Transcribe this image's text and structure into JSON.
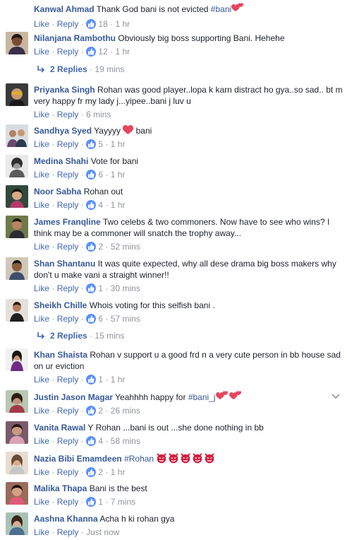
{
  "comments": [
    {
      "author": "Kanwal Ahmad",
      "text": "Thank God bani is not evicted ",
      "hashtag": "#bani",
      "like": "Like",
      "reply": "Reply",
      "likes": "18",
      "time": "1 hr"
    },
    {
      "author": "Nilanjana Rambothu",
      "text": "Obviously big boss supporting Bani. Hehehe",
      "like": "Like",
      "reply": "Reply",
      "likes": "12",
      "time": "1 hr",
      "replies_label": "2 Replies",
      "replies_time": "19 mins"
    },
    {
      "author": "Priyanka Singh",
      "text": "Rohan was good player..lopa k karn distract ho gya..so sad.. bt m very happy fr my lady j...yipee..bani j luv u",
      "like": "Like",
      "reply": "Reply",
      "time": "6 mins"
    },
    {
      "author": "Sandhya Syed",
      "text": "Yayyyy ",
      "text_after": " bani",
      "like": "Like",
      "reply": "Reply",
      "likes": "5",
      "time": "1 hr"
    },
    {
      "author": "Medina Shahi",
      "text": "Vote for bani",
      "like": "Like",
      "reply": "Reply",
      "likes": "6",
      "time": "1 hr"
    },
    {
      "author": "Noor Sabha",
      "text": "Rohan out",
      "like": "Like",
      "reply": "Reply",
      "likes": "4",
      "time": "1 hr"
    },
    {
      "author": "James Franqline",
      "text": "Two celebs & two commoners. Now have to see who wins? I think may be a commoner will snatch the trophy away...",
      "like": "Like",
      "reply": "Reply",
      "likes": "2",
      "time": "52 mins"
    },
    {
      "author": "Shan Shantanu",
      "text": "It was quite expected, why all dese drama big boss makers why don't u make vani a straight winner!!",
      "like": "Like",
      "reply": "Reply",
      "likes": "1",
      "time": "30 mins"
    },
    {
      "author": "Sheikh Chille",
      "text": "Whois voting for this selfish bani .",
      "like": "Like",
      "reply": "Reply",
      "likes": "6",
      "time": "57 mins",
      "replies_label": "2 Replies",
      "replies_time": "15 mins"
    },
    {
      "author": "Khan Shaista",
      "text": "Rohan v support u a good frd n a very cute person in bb house sad on ur eviction",
      "like": "Like",
      "reply": "Reply",
      "likes": "1",
      "time": "1 hr"
    },
    {
      "author": "Justin Jason Magar",
      "text": "Yeahhhh happy for ",
      "hashtag": "#bani_j",
      "like": "Like",
      "reply": "Reply",
      "likes": "2",
      "time": "26 mins"
    },
    {
      "author": "Vanita Rawal",
      "text": "Y Rohan ...bani is out ...she done nothing in bb",
      "like": "Like",
      "reply": "Reply",
      "likes": "4",
      "time": "58 mins"
    },
    {
      "author": "Nazia Bibi Emamdeen",
      "text": "",
      "hashtag": "#Rohan",
      "like": "Like",
      "reply": "Reply",
      "likes": "2",
      "time": "1 hr"
    },
    {
      "author": "Malika Thapa",
      "text": "Bani is the best",
      "like": "Like",
      "reply": "Reply",
      "likes": "1",
      "time": "7 mins"
    },
    {
      "author": "Aashna Khanna",
      "text": "Acha h ki rohan gya",
      "like": "Like",
      "reply": "Reply",
      "time": "Just now"
    }
  ],
  "separator": "·",
  "colors": {
    "link": "#4267b2",
    "author": "#365899",
    "meta": "#90949c",
    "like_badge": "#5890ff",
    "heart": "#e8455d",
    "devil": "#d1203f"
  },
  "icons": {
    "like": "thumbs-up-icon",
    "reply_arrow": "reply-arrow-icon",
    "heart": "heart-icon",
    "devil": "devil-emoji-icon",
    "menu": "chevron-down-icon"
  }
}
